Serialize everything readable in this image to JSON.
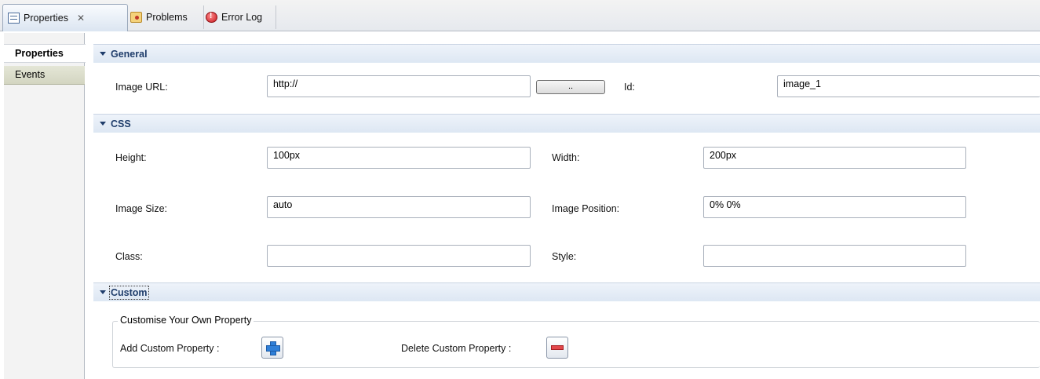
{
  "tabs": {
    "properties": "Properties",
    "properties_close": "✕",
    "problems": "Problems",
    "error_log": "Error Log"
  },
  "nav": {
    "properties": "Properties",
    "events": "Events"
  },
  "general": {
    "title": "General",
    "image_url_label": "Image URL:",
    "image_url_value": "http://",
    "browse_label": "..",
    "id_label": "Id:",
    "id_value": "image_1"
  },
  "css": {
    "title": "CSS",
    "height_label": "Height:",
    "height_value": "100px",
    "width_label": "Width:",
    "width_value": "200px",
    "image_size_label": "Image Size:",
    "image_size_value": "auto",
    "image_position_label": "Image Position:",
    "image_position_value": "0% 0%",
    "class_label": "Class:",
    "class_value": "",
    "style_label": "Style:",
    "style_value": ""
  },
  "custom": {
    "title": "Custom",
    "group_title": "Customise Your Own Property",
    "add_label": "Add Custom Property :",
    "delete_label": "Delete Custom Property :"
  },
  "icons": {
    "properties_tab": "properties-icon",
    "problems_tab": "problems-icon",
    "error_log_tab": "error-log-icon",
    "add": "plus-icon",
    "delete": "minus-icon"
  },
  "colors": {
    "section_header_text": "#1f3d6b",
    "add_icon": "#2f7fd8",
    "delete_icon": "#e2474b"
  }
}
